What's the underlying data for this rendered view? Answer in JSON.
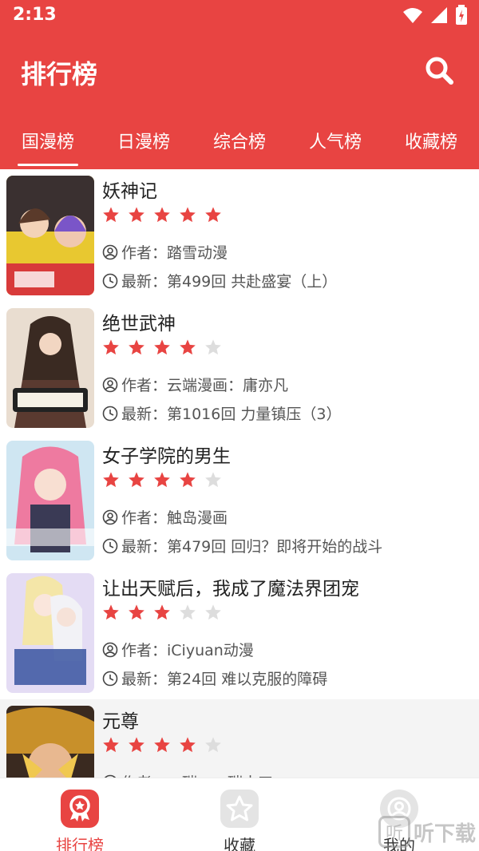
{
  "status_bar": {
    "time": "2:13"
  },
  "app_bar": {
    "title": "排行榜"
  },
  "tabs": [
    {
      "label": "国漫榜",
      "active": true
    },
    {
      "label": "日漫榜",
      "active": false
    },
    {
      "label": "综合榜",
      "active": false
    },
    {
      "label": "人气榜",
      "active": false
    },
    {
      "label": "收藏榜",
      "active": false
    }
  ],
  "comics": [
    {
      "title": "妖神记",
      "rating": 5,
      "author": "作者：踏雪动漫",
      "latest": "最新：第499回 共赴盛宴（上）"
    },
    {
      "title": "绝世武神",
      "rating": 4,
      "author": "作者：云端漫画：庸亦凡",
      "latest": "最新：第1016回 力量镇压（3）"
    },
    {
      "title": "女子学院的男生",
      "rating": 4,
      "author": "作者：触岛漫画",
      "latest": "最新：第479回 回归？即将开始的战斗"
    },
    {
      "title": "让出天赋后，我成了魔法界团宠",
      "rating": 3,
      "author": "作者：iCiyuan动漫",
      "latest": "最新：第24回 难以克服的障碍"
    },
    {
      "title": "元尊",
      "rating": 4,
      "author": "作者：二碳：二碳水工",
      "latest": ""
    }
  ],
  "bottom_nav": [
    {
      "label": "排行榜",
      "icon": "ranking-icon",
      "active": true
    },
    {
      "label": "收藏",
      "icon": "star-icon",
      "active": false
    },
    {
      "label": "我的",
      "icon": "user-icon",
      "active": false
    }
  ],
  "watermark": {
    "text": "听下载",
    "box": "听"
  },
  "colors": {
    "accent": "#e84442",
    "star_on": "#e84442",
    "star_off": "#dddddd"
  }
}
